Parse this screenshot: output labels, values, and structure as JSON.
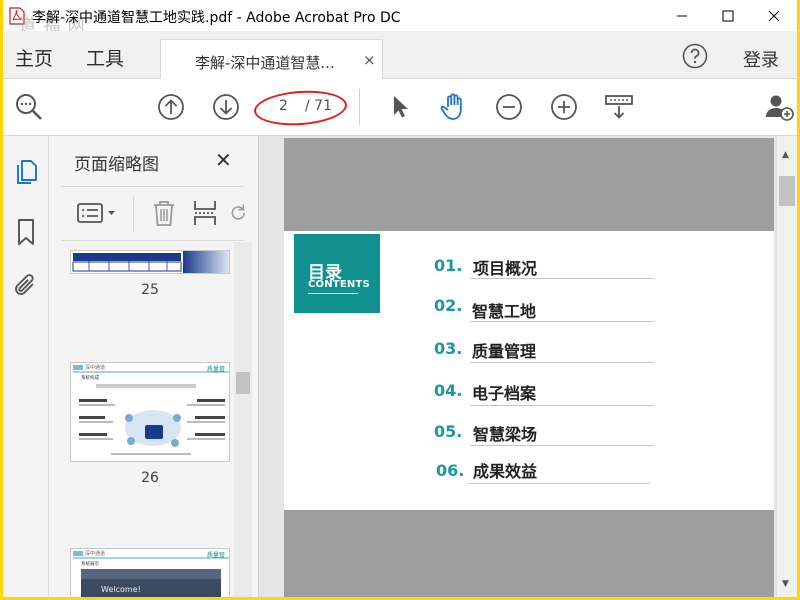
{
  "window": {
    "title": "李解-深中通道智慧工地实践.pdf - Adobe Acrobat Pro DC",
    "watermark": "道 福 网",
    "controls": [
      "minimize-icon",
      "maximize-icon",
      "close-icon"
    ]
  },
  "menu": {
    "home": "主页",
    "tools": "工具",
    "help_icon": "help-icon",
    "login": "登录"
  },
  "tab": {
    "label": "李解-深中通道智慧...",
    "close": "×"
  },
  "toolbar": {
    "current_page": "2",
    "total_pages": "/ 71",
    "icons": [
      "zoom-search-icon",
      "prev-page-icon",
      "next-page-icon",
      "select-cursor-icon",
      "hand-tool-icon",
      "zoom-out-icon",
      "zoom-in-icon",
      "page-display-icon",
      "add-user-icon"
    ],
    "annotation_color": "#e01e1e"
  },
  "rail": {
    "icons": [
      "page-thumbnails-icon",
      "bookmark-icon",
      "attachment-icon"
    ],
    "active_color": "#1a73c6"
  },
  "thumbnails": {
    "title": "页面缩略图",
    "close": "✕",
    "tools": [
      "options-icon",
      "delete-icon",
      "insert-page-icon",
      "rotate-icon"
    ],
    "pages": [
      {
        "number": "25"
      },
      {
        "number": "26",
        "header_brand": "深中通道",
        "header_tag": "质量管",
        "heading": "系统构成"
      },
      {
        "header_brand": "深中通道",
        "header_tag": "质量管",
        "heading": "系统展示",
        "banner": "Welcome!"
      }
    ]
  },
  "page": {
    "toc_title": "目录",
    "toc_subtitle": "CONTENTS",
    "accent": "#119090",
    "entries": [
      {
        "num": "01.",
        "label": "项目概况"
      },
      {
        "num": "02.",
        "label": "智慧工地"
      },
      {
        "num": "03.",
        "label": "质量管理"
      },
      {
        "num": "04.",
        "label": "电子档案"
      },
      {
        "num": "05.",
        "label": "智慧梁场"
      },
      {
        "num": "06.",
        "label": "成果效益"
      }
    ]
  }
}
